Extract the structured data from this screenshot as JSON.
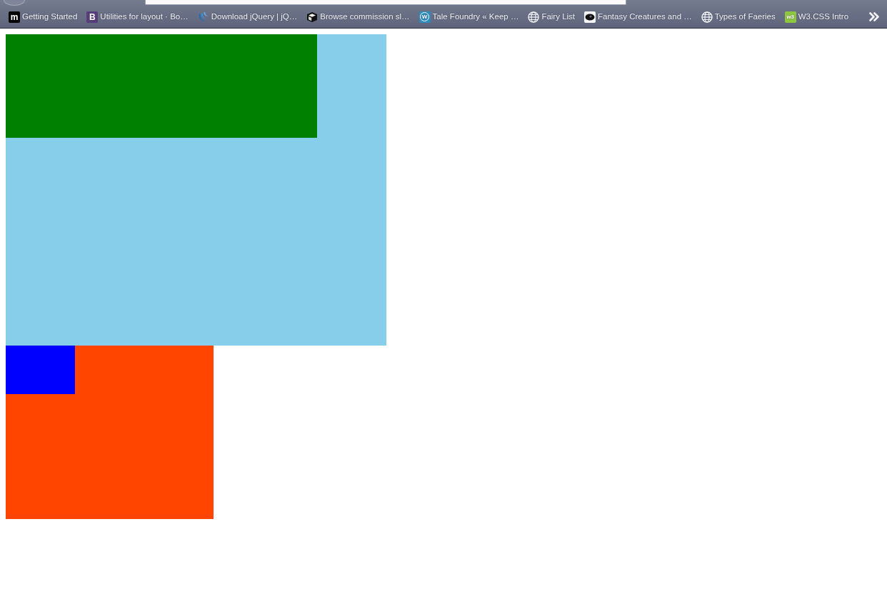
{
  "bookmarks_bar": {
    "items": [
      {
        "label": "Getting Started",
        "icon": {
          "kind": "tile",
          "text": "m",
          "color": "#000000"
        }
      },
      {
        "label": "Utilities for layout · Bo…",
        "icon": {
          "kind": "tile",
          "text": "B",
          "color": "#563d7c"
        }
      },
      {
        "label": "Download jQuery | jQ…",
        "icon": {
          "kind": "swirl"
        }
      },
      {
        "label": "Browse commission sl…",
        "icon": {
          "kind": "cube"
        }
      },
      {
        "label": "Tale Foundry « Keep …",
        "icon": {
          "kind": "ring",
          "text": "W",
          "color": "#2e8bc0"
        }
      },
      {
        "label": "Fairy List",
        "icon": {
          "kind": "globe"
        }
      },
      {
        "label": "Fantasy Creatures and …",
        "icon": {
          "kind": "eye"
        }
      },
      {
        "label": "Types of Faeries",
        "icon": {
          "kind": "globe"
        }
      },
      {
        "label": "W3.CSS Intro",
        "icon": {
          "kind": "tile",
          "text": "w3",
          "color": "#8dc63f"
        }
      }
    ]
  },
  "page": {
    "blocks": [
      {
        "color": "#87ceeb",
        "inner": {
          "color": "#008000"
        }
      },
      {
        "color": "#ff4500",
        "inner": {
          "color": "#0000ff"
        }
      }
    ]
  }
}
